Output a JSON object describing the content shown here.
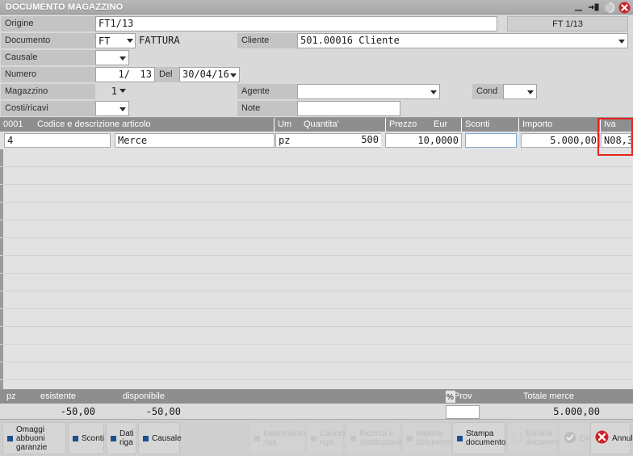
{
  "window": {
    "title": "DOCUMENTO MAGAZZINO",
    "buttons": {
      "minimize": "minimize-icon",
      "restore": "restore-icon",
      "close": "close-icon"
    }
  },
  "form": {
    "origine_label": "Origine",
    "origine_value": "FT1/13",
    "origine_badge": "FT 1/13",
    "documento_label": "Documento",
    "documento_code": "FT",
    "documento_desc": "FATTURA",
    "cliente_label": "Cliente",
    "cliente_value": "501.00016 Cliente",
    "causale_label": "Causale",
    "causale_value": "",
    "numero_label": "Numero",
    "numero_value": "1/",
    "numero_serie": "13",
    "del_label": "Del",
    "data_value": "30/04/16",
    "magazzino_label": "Magazzino",
    "magazzino_value": "1",
    "agente_label": "Agente",
    "agente_value": "",
    "cond_label": "Cond",
    "cond_value": "",
    "costiricavi_label": "Costi/ricavi",
    "costiricavi_value": "",
    "note_label": "Note",
    "note_value": ""
  },
  "grid": {
    "headers": {
      "rownum": "0001",
      "descrizione": "Codice e descrizione articolo",
      "um": "Um",
      "quantita": "Quantita'",
      "prezzo": "Prezzo",
      "eur": "Eur",
      "sconti": "Sconti",
      "importo": "Importo",
      "iva": "Iva"
    },
    "row": {
      "codice": "4",
      "descrizione": "Merce",
      "um": "pz",
      "quantita": "500",
      "prezzo": "10,0000",
      "sconti": "",
      "importo": "5.000,00",
      "iva": "N08,3"
    },
    "highlight_color": "#e8241e",
    "empty_row_count": 13
  },
  "totals": {
    "um_label": "pz",
    "esistente_label": "esistente",
    "disponibile_label": "disponibile",
    "esistente_value": "-50,00",
    "disponibile_value": "-50,00",
    "prov_label": "Prov",
    "prov_percent_icon": "percent-icon",
    "prov_value": "",
    "totale_merce_label": "Totale merce",
    "totale_merce_value": "5.000,00"
  },
  "toolbar": {
    "buttons": [
      {
        "id": "omaggi-abbuoni-garanzie",
        "label": "Omaggi abbuoni\ngaranzie",
        "enabled": true,
        "icon": "square-icon"
      },
      {
        "id": "sconti",
        "label": "Sconti",
        "enabled": true,
        "icon": "square-icon"
      },
      {
        "id": "dati-riga",
        "label": "Dati\nriga",
        "enabled": true,
        "icon": "square-icon"
      },
      {
        "id": "causale",
        "label": "Causale",
        "enabled": true,
        "icon": "square-icon"
      },
      {
        "id": "inserimento-riga",
        "label": "Inserimento\nriga",
        "enabled": false,
        "icon": "square-icon"
      },
      {
        "id": "cancella-riga",
        "label": "Cancella\nriga",
        "enabled": false,
        "icon": "square-icon"
      },
      {
        "id": "ricerca-e-sostituzione",
        "label": "Ricerca e\nsostituzione",
        "enabled": false,
        "icon": "square-icon"
      },
      {
        "id": "importa-documento",
        "label": "Importa\ndocumento",
        "enabled": false,
        "icon": "square-icon"
      },
      {
        "id": "stampa-documento",
        "label": "Stampa\ndocumento",
        "enabled": true,
        "icon": "square-icon"
      },
      {
        "id": "elimina-documento",
        "label": "Elimina\ndocumento",
        "enabled": false,
        "icon": "trash-icon"
      },
      {
        "id": "ok",
        "label": "Ok",
        "enabled": false,
        "icon": "check-circle-icon"
      },
      {
        "id": "annulla",
        "label": "Annulla",
        "enabled": true,
        "icon": "cancel-circle-icon"
      }
    ]
  },
  "colors": {
    "accent_red": "#cc2229",
    "title_bar": "#b0b0b0",
    "header_grey": "#8e8e8e",
    "field_bg": "#ffffff"
  }
}
